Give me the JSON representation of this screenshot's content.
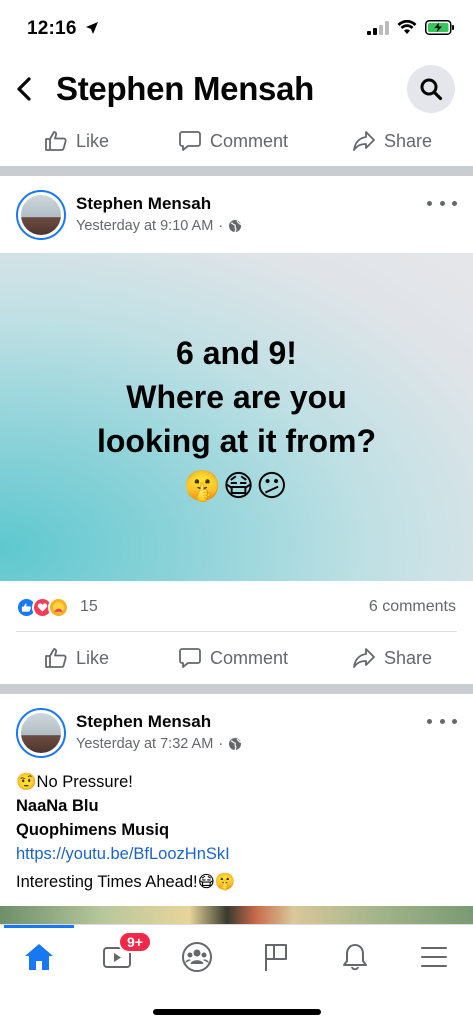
{
  "status_bar": {
    "time": "12:16"
  },
  "header": {
    "title": "Stephen Mensah"
  },
  "actions": {
    "like": "Like",
    "comment": "Comment",
    "share": "Share"
  },
  "post1": {
    "author": "Stephen Mensah",
    "time": "Yesterday at 9:10 AM",
    "separator": "·",
    "image_text_line1": "6 and 9!",
    "image_text_line2": "Where are you",
    "image_text_line3": "looking at it from?",
    "image_emoji": "🤫😷😕",
    "reaction_count": "15",
    "comments_count": "6 comments"
  },
  "post2": {
    "author": "Stephen Mensah",
    "time": "Yesterday at 7:32 AM",
    "separator": "·",
    "line1_emoji": "🤨",
    "line1": "No Pressure!",
    "line2": "NaaNa Blu",
    "line3": "Quophimens Musiq",
    "link": "https://youtu.be/BfLoozHnSkI",
    "line5": "Interesting Times Ahead!",
    "line5_emoji": "😷🤫"
  },
  "nav": {
    "watch_badge": "9+"
  },
  "colors": {
    "brand_blue": "#1877f2",
    "badge_red": "#f02849",
    "secondary_text": "#65676b"
  }
}
